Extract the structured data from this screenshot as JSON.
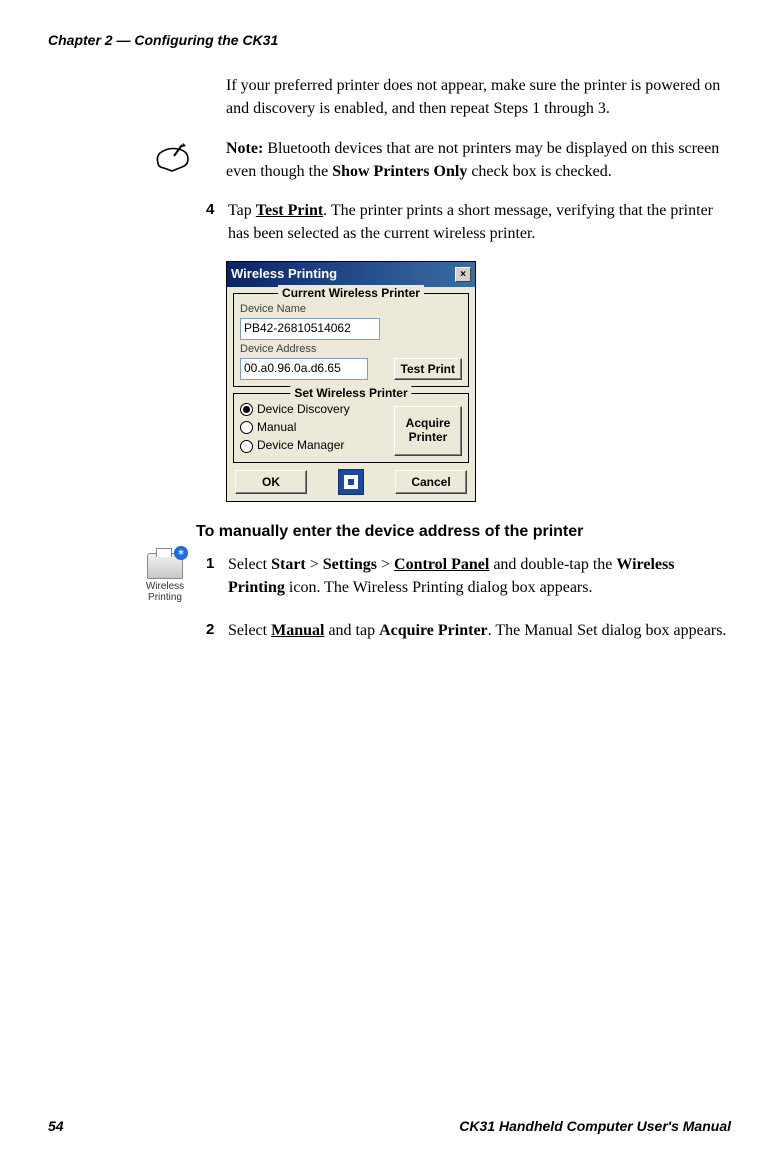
{
  "header": "Chapter 2 — Configuring the CK31",
  "intro_paragraph": "If your preferred printer does not appear, make sure the printer is powered on and discovery is enabled, and then repeat Steps 1 through 3.",
  "note": {
    "prefix": "Note:",
    "body_part1": " Bluetooth devices that are not printers may be displayed on this screen even though the ",
    "bold_phrase": "Show Printers Only",
    "body_part2": " check box is checked."
  },
  "step4": {
    "num": "4",
    "label_prefix": "Tap ",
    "tap_target": "Test Print",
    "label_suffix": ". The printer prints a short message, verifying that the printer has been selected as the current wireless printer."
  },
  "dialog": {
    "title": "Wireless Printing",
    "group1_legend": "Current Wireless Printer",
    "device_name_label": "Device Name",
    "device_name_value": "PB42-26810514062",
    "device_address_label": "Device Address",
    "device_address_value": "00.a0.96.0a.d6.65",
    "test_print_btn": "Test Print",
    "group2_legend": "Set Wireless Printer",
    "radios": {
      "discovery": "Device Discovery",
      "manual": "Manual",
      "manager": "Device Manager"
    },
    "acquire_btn_line1": "Acquire",
    "acquire_btn_line2": "Printer",
    "ok_btn": "OK",
    "cancel_btn": "Cancel"
  },
  "section_heading": "To manually enter the device address of the printer",
  "wp_icon_label": "Wireless\nPrinting",
  "step1": {
    "num": "1",
    "t1": "Select ",
    "start": "Start",
    "gt1": " > ",
    "settings": "Settings",
    "gt2": " > ",
    "cp": "Control Panel",
    "t2": " and double-tap the ",
    "wp": "Wireless Printing",
    "t3": " icon. The Wireless Printing dialog box appears."
  },
  "step2": {
    "num": "2",
    "t1": "Select ",
    "manual": "Manual",
    "t2": " and tap ",
    "acquire": "Acquire Printer",
    "t3": ". The Manual Set dialog box appears."
  },
  "footer": {
    "page_num": "54",
    "manual_title": "CK31 Handheld Computer User's Manual"
  }
}
